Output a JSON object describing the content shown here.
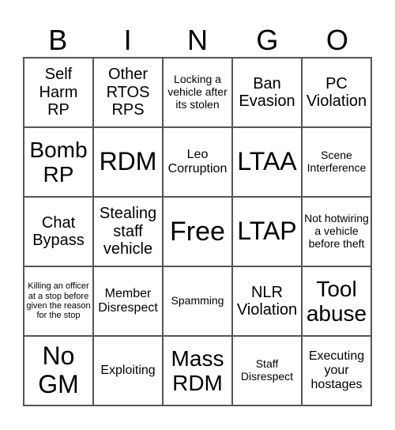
{
  "header": [
    "B",
    "I",
    "N",
    "G",
    "O"
  ],
  "cells": [
    "Self Harm RP",
    "Other RTOS RPS",
    "Locking a vehicle after its stolen",
    "Ban Evasion",
    "PC Violation",
    "Bomb RP",
    "RDM",
    "Leo Corruption",
    "LTAA",
    "Scene Interference",
    "Chat Bypass",
    "Stealing staff vehicle",
    "Free",
    "LTAP",
    "Not hotwiring a vehicle before theft",
    "Killing an officer at a stop before given the reason for the stop",
    "Member Disrespect",
    "Spamming",
    "NLR Violation",
    "Tool abuse",
    "No GM",
    "Exploiting",
    "Mass RDM",
    "Staff Disrespect",
    "Executing your hostages"
  ]
}
